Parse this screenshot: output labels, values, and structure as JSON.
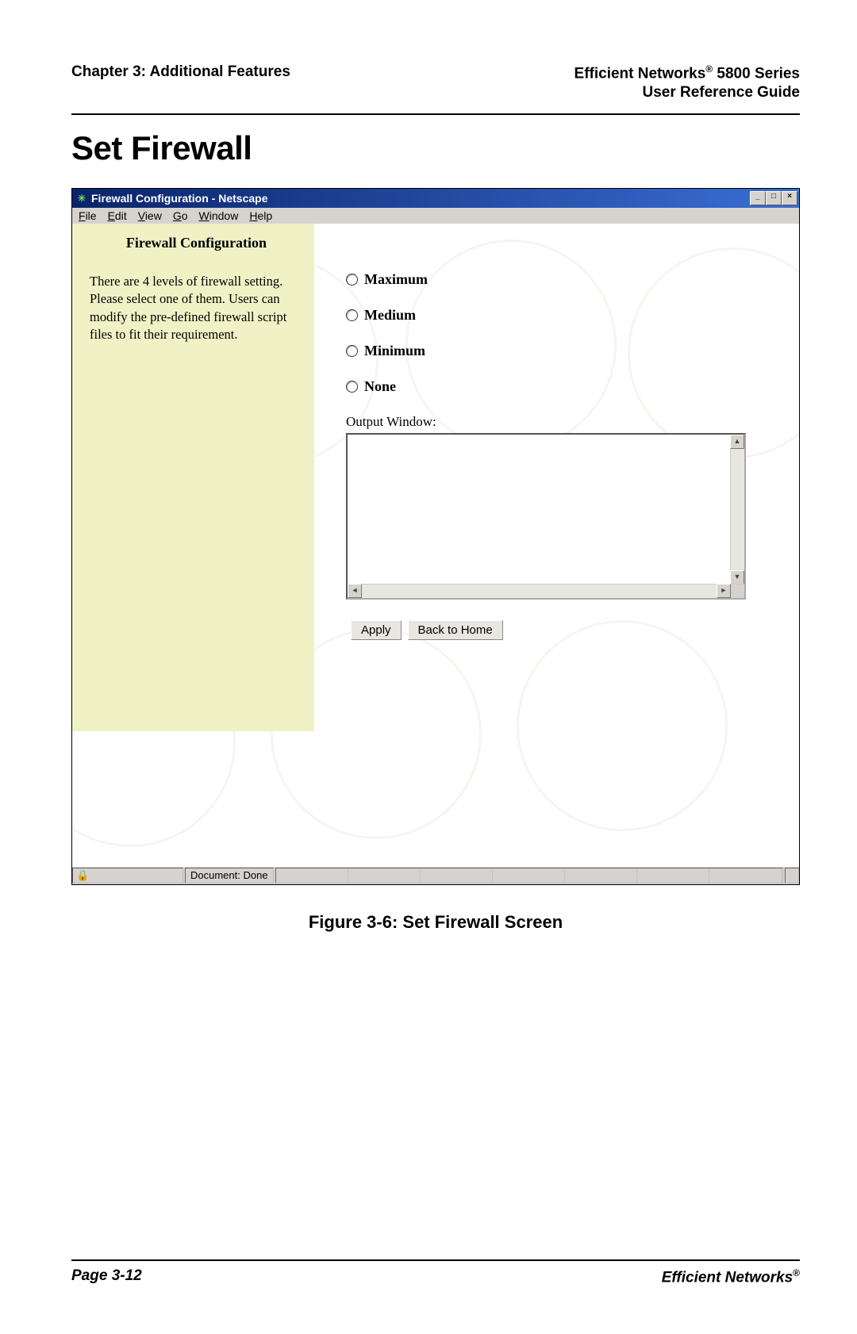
{
  "header": {
    "left": "Chapter 3: Additional Features",
    "right_line1": "Efficient Networks® 5800 Series",
    "right_line2": "User Reference Guide"
  },
  "page_title": "Set Firewall",
  "browser": {
    "title": "Firewall Configuration - Netscape",
    "menus": [
      "File",
      "Edit",
      "View",
      "Go",
      "Window",
      "Help"
    ],
    "win_buttons": {
      "min": "_",
      "max": "□",
      "close": "×"
    }
  },
  "sidebar": {
    "title": "Firewall Configuration",
    "body": "There are 4 levels of firewall setting. Please select one of them. Users can modify the pre-defined firewall script files to fit their requirement."
  },
  "options": [
    "Maximum",
    "Medium",
    "Minimum",
    "None"
  ],
  "output_label": "Output Window:",
  "buttons": {
    "apply": "Apply",
    "home": "Back to Home"
  },
  "status": "Document: Done",
  "figure_caption": "Figure 3-6:  Set Firewall Screen",
  "footer": {
    "left": "Page 3-12",
    "right": "Efficient Networks®"
  }
}
